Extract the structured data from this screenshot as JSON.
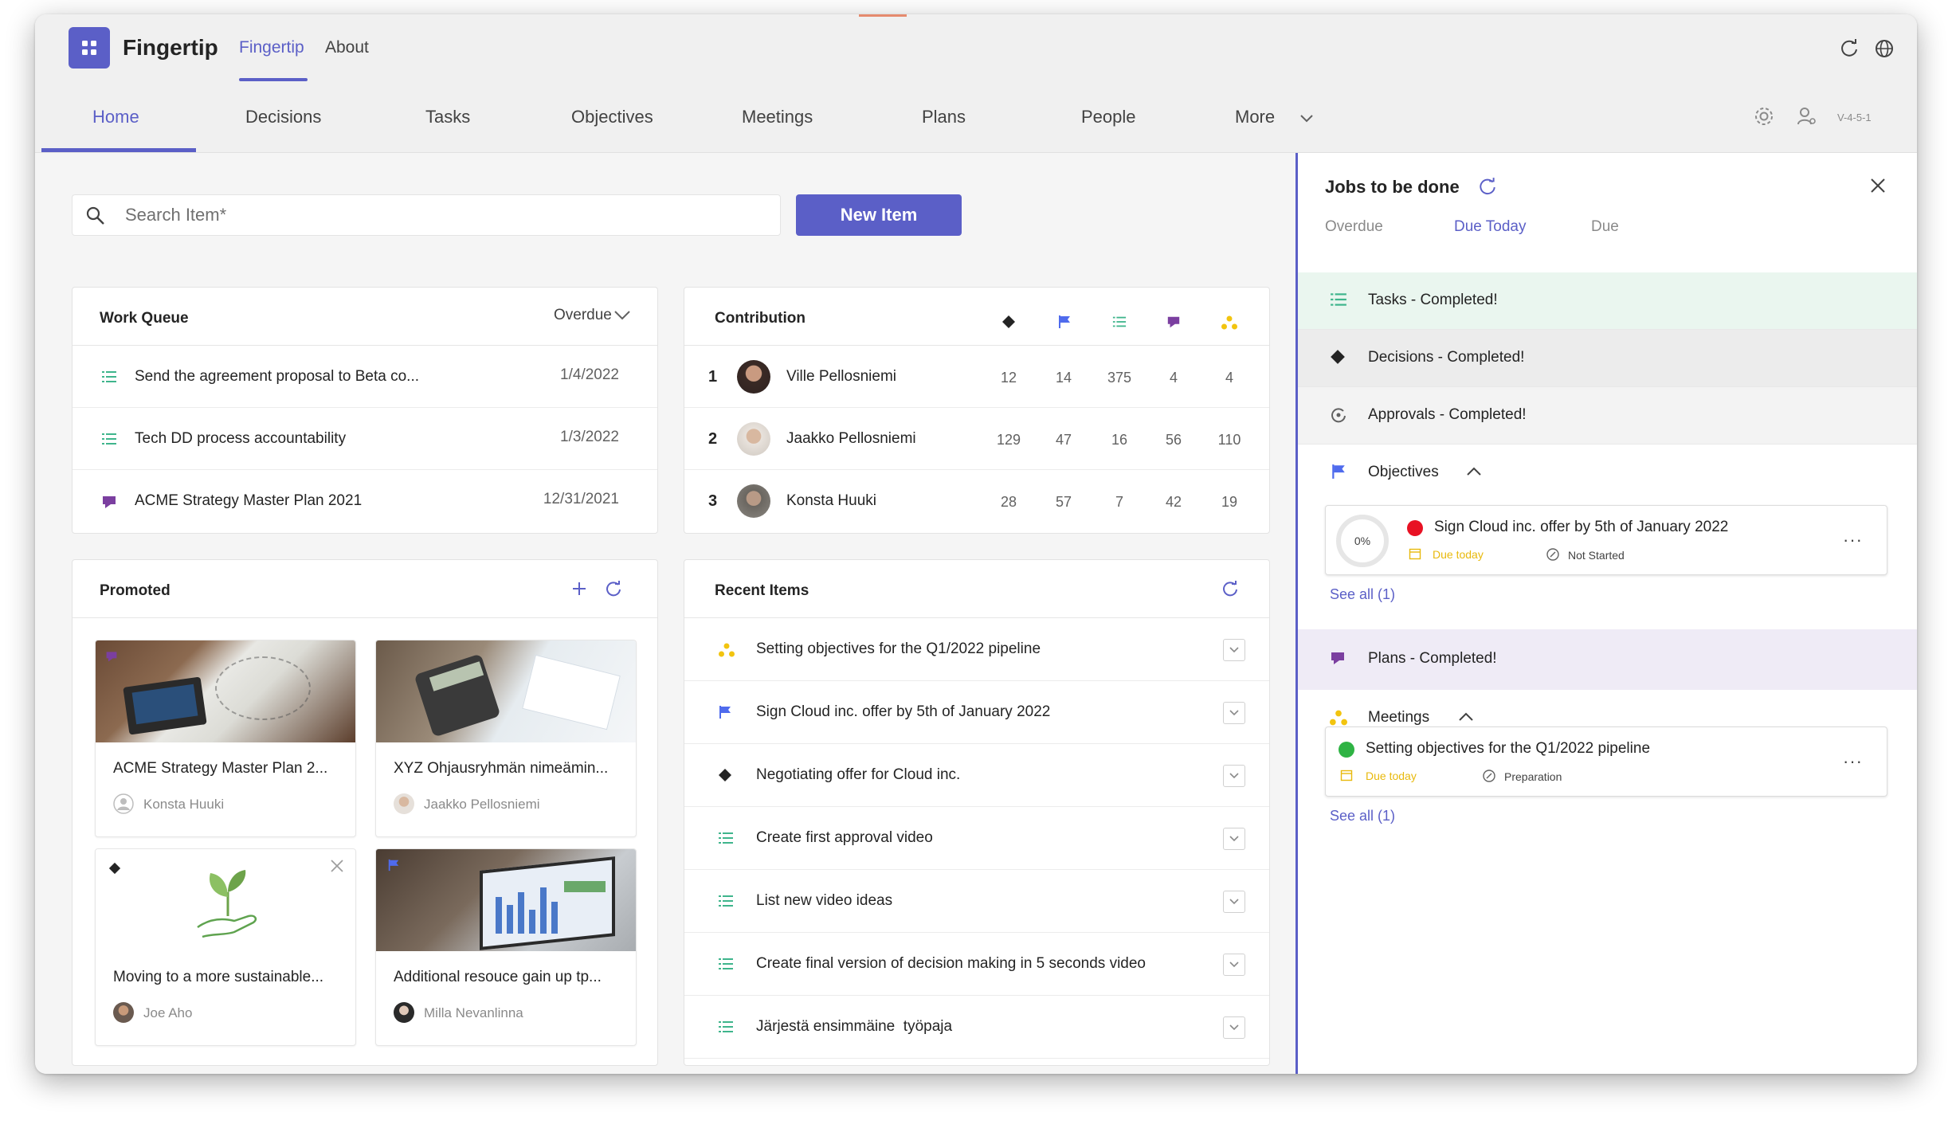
{
  "appbar": {
    "app_name": "Fingertip",
    "tabs": [
      "Fingertip",
      "About"
    ]
  },
  "nav": {
    "tabs": [
      "Home",
      "Decisions",
      "Tasks",
      "Objectives",
      "Meetings",
      "Plans",
      "People",
      "More"
    ],
    "version": "V-4-5-1"
  },
  "search": {
    "placeholder": "Search Item*"
  },
  "new_item_label": "New Item",
  "work_queue": {
    "title": "Work Queue",
    "filter": "Overdue",
    "items": [
      {
        "icon": "task-icon",
        "text": "Send the agreement proposal to Beta co...",
        "date": "1/4/2022"
      },
      {
        "icon": "task-icon",
        "text": "Tech DD process accountability",
        "date": "1/3/2022"
      },
      {
        "icon": "plan-icon",
        "text": "ACME Strategy Master Plan 2021",
        "date": "12/31/2021"
      }
    ]
  },
  "contribution": {
    "title": "Contribution",
    "rows": [
      {
        "rank": "1",
        "name": "Ville Pellosniemi",
        "values": [
          "12",
          "14",
          "375",
          "4",
          "4"
        ]
      },
      {
        "rank": "2",
        "name": "Jaakko Pellosniemi",
        "values": [
          "129",
          "47",
          "16",
          "56",
          "110"
        ]
      },
      {
        "rank": "3",
        "name": "Konsta Huuki",
        "values": [
          "28",
          "57",
          "7",
          "42",
          "19"
        ]
      }
    ]
  },
  "promoted": {
    "title": "Promoted",
    "tiles": [
      {
        "title": "ACME Strategy Master Plan 2...",
        "author": "Konsta Huuki"
      },
      {
        "title": "XYZ Ohjausryhmän nimeämin...",
        "author": "Jaakko Pellosniemi"
      },
      {
        "title": "Moving to a more sustainable...",
        "author": "Joe Aho"
      },
      {
        "title": "Additional resouce gain up tp...",
        "author": "Milla Nevanlinna"
      }
    ]
  },
  "recent_items": {
    "title": "Recent Items",
    "items": [
      "Setting objectives for the Q1/2022 pipeline",
      "Sign Cloud inc. offer by 5th of January 2022",
      "Negotiating offer for Cloud inc.",
      "Create first approval video",
      "List new video ideas",
      "Create final version of decision making in 5 seconds video",
      "Järjestä ensimmäine  työpaja"
    ]
  },
  "jobs_panel": {
    "title": "Jobs to be done",
    "tabs": [
      "Overdue",
      "Due Today",
      "Due"
    ],
    "completed_rows": [
      "Tasks - Completed!",
      "Decisions - Completed!",
      "Approvals - Completed!"
    ],
    "objectives_label": "Objectives",
    "objective_card": {
      "progress": "0%",
      "title": "Sign Cloud inc. offer by 5th of January 2022",
      "due": "Due today",
      "status": "Not Started"
    },
    "see_all_objectives": "See all (1)",
    "plans_row": "Plans - Completed!",
    "meetings_label": "Meetings",
    "meeting_card": {
      "title": "Setting objectives for the Q1/2022 pipeline",
      "due": "Due today",
      "status": "Preparation"
    },
    "see_all_meetings": "See all (1)"
  },
  "colors": {
    "brand": "#5b5fc7",
    "task_green": "#3fb58c",
    "plan_purple": "#7b3fa0",
    "meeting_yellow": "#f2c40f",
    "objective_blue": "#4f6bed",
    "overdue_red": "#e81123",
    "done_green": "#2fb344"
  }
}
